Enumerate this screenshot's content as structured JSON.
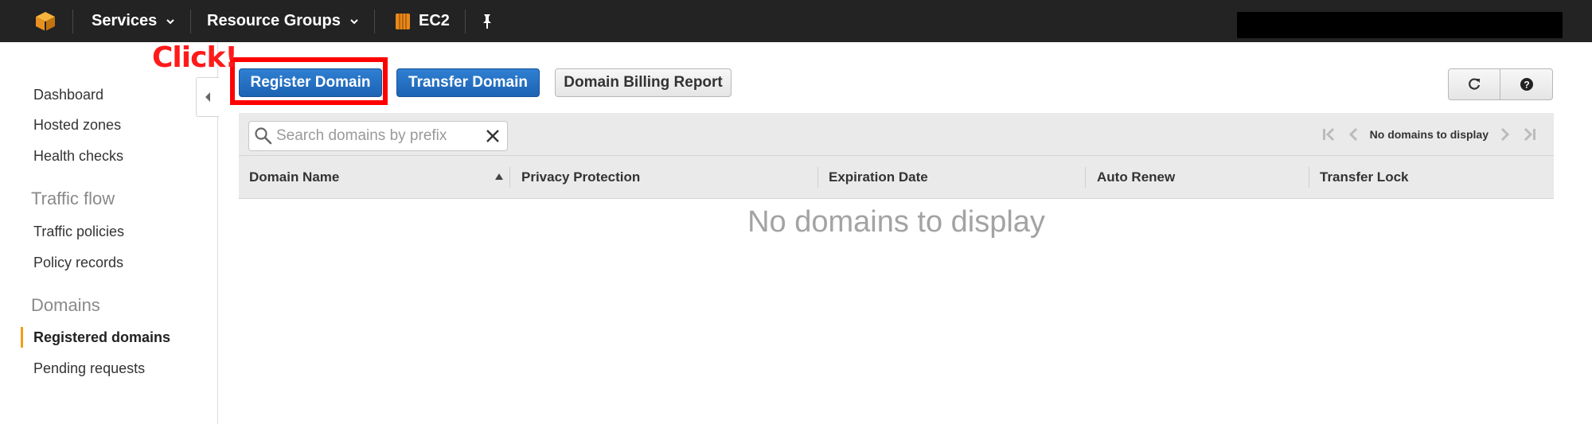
{
  "topnav": {
    "services_label": "Services",
    "resource_groups_label": "Resource Groups",
    "ec2_label": "EC2",
    "accent_color": "#f0a016"
  },
  "sidebar": {
    "items": [
      {
        "label": "Dashboard"
      },
      {
        "label": "Hosted zones"
      },
      {
        "label": "Health checks"
      }
    ],
    "traffic_flow": {
      "heading": "Traffic flow",
      "items": [
        {
          "label": "Traffic policies"
        },
        {
          "label": "Policy records"
        }
      ]
    },
    "domains": {
      "heading": "Domains",
      "items": [
        {
          "label": "Registered domains",
          "active": true
        },
        {
          "label": "Pending requests"
        }
      ]
    }
  },
  "annotation": {
    "click_label": "Click!",
    "highlight_color": "#ff0000"
  },
  "toolbar": {
    "register_domain_label": "Register Domain",
    "transfer_domain_label": "Transfer Domain",
    "billing_report_label": "Domain Billing Report",
    "refresh_icon": "refresh-icon",
    "help_icon": "help-icon"
  },
  "search": {
    "placeholder": "Search domains by prefix",
    "value": ""
  },
  "pager": {
    "status_text": "No domains to display"
  },
  "table": {
    "columns": [
      "Domain Name",
      "Privacy Protection",
      "Expiration Date",
      "Auto Renew",
      "Transfer Lock"
    ],
    "rows": [],
    "empty_message": "No domains to display"
  }
}
